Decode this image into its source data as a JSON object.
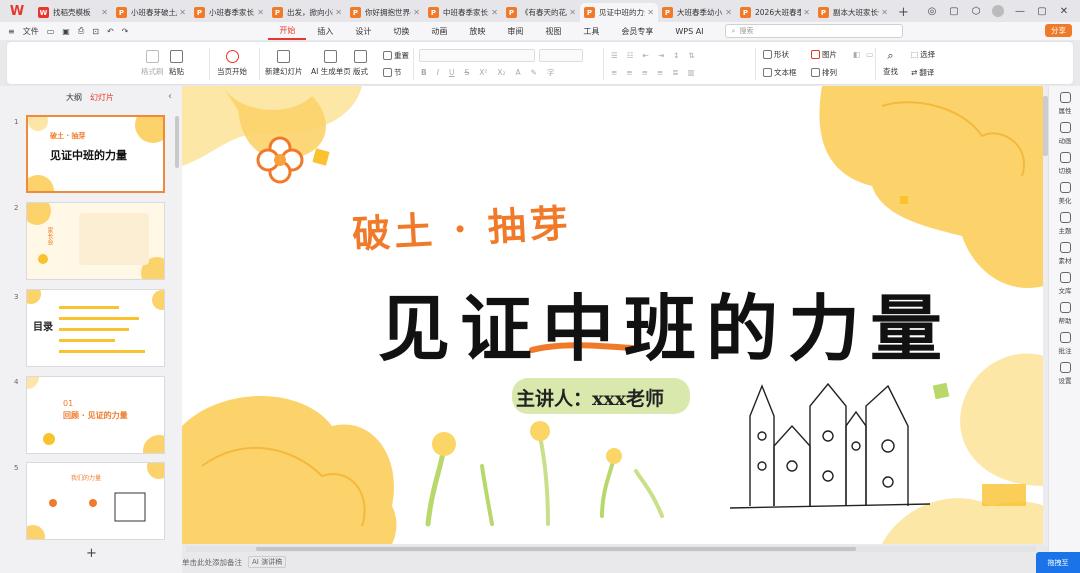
{
  "app": {
    "logo": "W",
    "share_label": "分享"
  },
  "tabs": [
    {
      "label": "找稻壳模板",
      "color": "#e7362b",
      "icon": "W"
    },
    {
      "label": "小班春芽破土成…",
      "color": "#f07a2a",
      "icon": "P"
    },
    {
      "label": "小班春季家长…",
      "color": "#f07a2a",
      "icon": "P"
    },
    {
      "label": "出发，掀向小班…",
      "color": "#f07a2a",
      "icon": "P"
    },
    {
      "label": "你好拥抱世界-中…",
      "color": "#f07a2a",
      "icon": "P"
    },
    {
      "label": "中班春季家长…",
      "color": "#f07a2a",
      "icon": "P"
    },
    {
      "label": "《有春天的花。》…",
      "color": "#f07a2a",
      "icon": "P"
    },
    {
      "label": "见证中班的力量…",
      "color": "#f07a2a",
      "icon": "P",
      "active": true
    },
    {
      "label": "大班春季幼小…",
      "color": "#f07a2a",
      "icon": "P"
    },
    {
      "label": "2026大班春季…",
      "color": "#f07a2a",
      "icon": "P"
    },
    {
      "label": "副本大班家长会…",
      "color": "#f07a2a",
      "icon": "P"
    }
  ],
  "menu": {
    "file": "文件",
    "tabs": [
      "开始",
      "插入",
      "设计",
      "切换",
      "动画",
      "放映",
      "审阅",
      "视图",
      "工具",
      "会员专享",
      "WPS AI"
    ],
    "search_placeholder": "搜索"
  },
  "ribbon": {
    "format_painter": "格式刷",
    "paste": "粘贴",
    "play_from": "当页开始",
    "new_slide": "新建幻灯片",
    "ai_gen": "AI 生成单页",
    "layout": "版式",
    "section": "节",
    "reset": "重置",
    "shape": "形状",
    "picture": "图片",
    "textbox": "文本框",
    "arrange": "排列",
    "find": "查找",
    "select": "选择",
    "translate": "翻译"
  },
  "left_pane": {
    "tab_outline": "大纲",
    "tab_slides": "幻灯片",
    "slides": [
      {
        "num": "1",
        "title": "见证中班的力量",
        "sub": "破土 · 抽芽"
      },
      {
        "num": "2",
        "title": "家长会",
        "sub": ""
      },
      {
        "num": "3",
        "title": "目录",
        "sub": ""
      },
      {
        "num": "4",
        "title": "回顾 · 见证的力量",
        "sub": "01"
      },
      {
        "num": "5",
        "title": "我们的力量",
        "sub": ""
      }
    ]
  },
  "slide": {
    "subtitle": "破土 · 抽芽",
    "title": "见证中班的力量",
    "presenter": "主讲人：xxx老师"
  },
  "notes": {
    "placeholder": "单击此处添加备注",
    "ai_notes": "AI 演讲稿"
  },
  "right_panel": {
    "items": [
      "属性",
      "动画",
      "切换",
      "美化",
      "主题",
      "素材",
      "文库",
      "帮助",
      "批注",
      "设置"
    ]
  },
  "assistant": "拖拽至"
}
